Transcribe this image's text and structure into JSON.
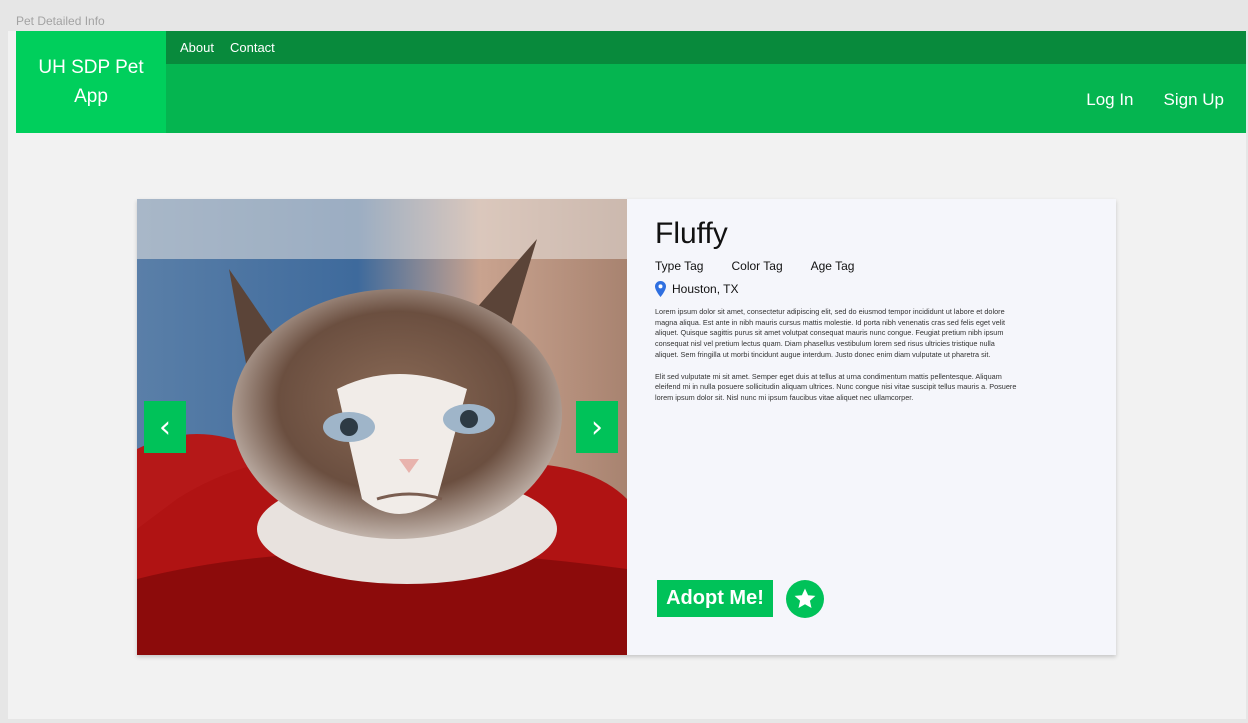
{
  "window": {
    "title": "Pet Detailed Info"
  },
  "brand": {
    "name": "UH SDP Pet App"
  },
  "nav": {
    "top_links": [
      "About",
      "Contact"
    ],
    "login": "Log In",
    "signup": "Sign Up"
  },
  "pet": {
    "name": "Fluffy",
    "tags": [
      "Type Tag",
      "Color Tag",
      "Age Tag"
    ],
    "location": "Houston, TX",
    "description": [
      "Lorem ipsum dolor sit amet, consectetur adipiscing elit, sed do eiusmod tempor incididunt ut labore et dolore magna aliqua. Est ante in nibh mauris cursus mattis molestie. Id porta nibh venenatis cras sed felis eget velit aliquet. Quisque sagittis purus sit amet volutpat consequat mauris nunc congue. Feugiat pretium nibh ipsum consequat nisl vel pretium lectus quam. Diam phasellus vestibulum lorem sed risus ultricies tristique nulla aliquet. Sem fringilla ut morbi tincidunt augue interdum. Justo donec enim diam vulputate ut pharetra sit.",
      "Elit sed vulputate mi sit amet. Semper eget duis at tellus at urna condimentum mattis pellentesque. Aliquam eleifend mi in nulla posuere sollicitudin aliquam ultrices. Nunc congue nisi vitae suscipit tellus mauris a. Posuere lorem ipsum dolor sit. Nisl nunc mi ipsum faucibus vitae aliquet nec ullamcorper."
    ]
  },
  "actions": {
    "adopt_label": "Adopt Me!"
  },
  "icons": {
    "prev": "chevron-left-icon",
    "next": "chevron-right-icon",
    "location": "map-pin-icon",
    "favorite": "star-icon"
  },
  "colors": {
    "accent": "#00c259",
    "nav_dark": "#088a3c",
    "nav": "#05b550",
    "brand_bg": "#00cf5c",
    "pin": "#2f6fe0"
  }
}
